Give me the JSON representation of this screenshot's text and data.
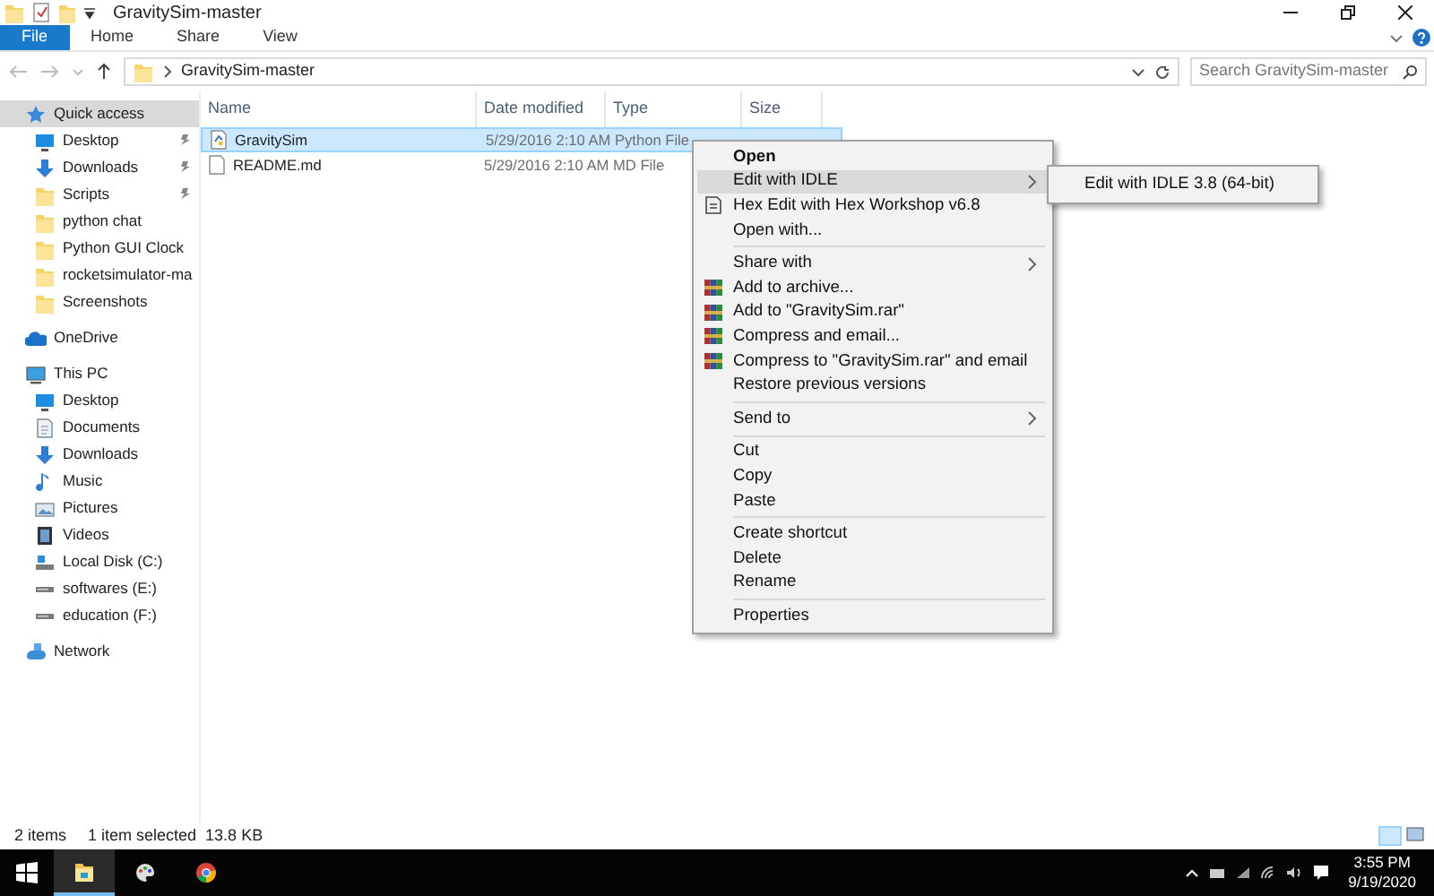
{
  "window": {
    "title": "GravitySim-master"
  },
  "ribbon_tabs": [
    {
      "label": "File",
      "selected": true
    },
    {
      "label": "Home",
      "selected": false
    },
    {
      "label": "Share",
      "selected": false
    },
    {
      "label": "View",
      "selected": false
    }
  ],
  "address": {
    "path": "GravitySim-master",
    "search_placeholder": "Search GravitySim-master"
  },
  "sidebar": {
    "items": [
      {
        "label": "Quick access",
        "kind": "star",
        "selected": true,
        "pinned": false,
        "children": [
          {
            "label": "Desktop",
            "kind": "desktop",
            "selected": false,
            "pinned": true
          },
          {
            "label": "Downloads",
            "kind": "download",
            "selected": false,
            "pinned": true
          },
          {
            "label": "Scripts",
            "kind": "folder",
            "selected": false,
            "pinned": true
          },
          {
            "label": "python chat",
            "kind": "folder",
            "selected": false,
            "pinned": false
          },
          {
            "label": "Python GUI Clock",
            "kind": "folder",
            "selected": false,
            "pinned": false
          },
          {
            "label": "rocketsimulator-ma",
            "kind": "folder",
            "selected": false,
            "pinned": false
          },
          {
            "label": "Screenshots",
            "kind": "folder",
            "selected": false,
            "pinned": false
          }
        ]
      },
      {
        "label": "OneDrive",
        "kind": "cloud",
        "selected": false,
        "pinned": false
      },
      {
        "label": "This PC",
        "kind": "pc",
        "selected": false,
        "pinned": false,
        "children": [
          {
            "label": "Desktop",
            "kind": "desktop",
            "selected": false,
            "pinned": false
          },
          {
            "label": "Documents",
            "kind": "document",
            "selected": false,
            "pinned": false
          },
          {
            "label": "Downloads",
            "kind": "download",
            "selected": false,
            "pinned": false
          },
          {
            "label": "Music",
            "kind": "music",
            "selected": false,
            "pinned": false
          },
          {
            "label": "Pictures",
            "kind": "pictures",
            "selected": false,
            "pinned": false
          },
          {
            "label": "Videos",
            "kind": "videos",
            "selected": false,
            "pinned": false
          },
          {
            "label": "Local Disk (C:)",
            "kind": "sysdrive",
            "selected": false,
            "pinned": false
          },
          {
            "label": "softwares (E:)",
            "kind": "drive",
            "selected": false,
            "pinned": false
          },
          {
            "label": "education (F:)",
            "kind": "drive",
            "selected": false,
            "pinned": false
          }
        ]
      },
      {
        "label": "Network",
        "kind": "network",
        "selected": false,
        "pinned": false
      }
    ]
  },
  "table": {
    "columns": [
      "Name",
      "Date modified",
      "Type",
      "Size"
    ],
    "rows": [
      {
        "name": "GravitySim",
        "kind": "python",
        "date": "5/29/2016 2:10 AM",
        "type": "Python File",
        "selected": true
      },
      {
        "name": "README.md",
        "kind": "text",
        "date": "5/29/2016 2:10 AM",
        "type": "MD File",
        "selected": false
      }
    ]
  },
  "context_menu": {
    "groups": [
      [
        {
          "label": "Open",
          "default": true,
          "selected": false,
          "submenu": false
        },
        {
          "label": "Edit with IDLE",
          "default": false,
          "selected": true,
          "submenu": true
        },
        {
          "label": "Hex Edit with Hex Workshop v6.8",
          "default": false,
          "selected": false,
          "submenu": false,
          "kind": "hex"
        },
        {
          "label": "Open with...",
          "default": false,
          "selected": false,
          "submenu": false
        }
      ],
      [
        {
          "label": "Share with",
          "default": false,
          "selected": false,
          "submenu": true
        },
        {
          "label": "Add to archive...",
          "default": false,
          "selected": false,
          "submenu": false,
          "kind": "archive"
        },
        {
          "label": "Add to \"GravitySim.rar\"",
          "default": false,
          "selected": false,
          "submenu": false,
          "kind": "archive"
        },
        {
          "label": "Compress and email...",
          "default": false,
          "selected": false,
          "submenu": false,
          "kind": "archive"
        },
        {
          "label": "Compress to \"GravitySim.rar\" and email",
          "default": false,
          "selected": false,
          "submenu": false,
          "kind": "archive"
        },
        {
          "label": "Restore previous versions",
          "default": false,
          "selected": false,
          "submenu": false
        }
      ],
      [
        {
          "label": "Send to",
          "default": false,
          "selected": false,
          "submenu": true
        }
      ],
      [
        {
          "label": "Cut",
          "default": false,
          "selected": false,
          "submenu": false
        },
        {
          "label": "Copy",
          "default": false,
          "selected": false,
          "submenu": false
        },
        {
          "label": "Paste",
          "default": false,
          "selected": false,
          "submenu": false
        }
      ],
      [
        {
          "label": "Create shortcut",
          "default": false,
          "selected": false,
          "submenu": false
        },
        {
          "label": "Delete",
          "default": false,
          "selected": false,
          "submenu": false
        },
        {
          "label": "Rename",
          "default": false,
          "selected": false,
          "submenu": false
        }
      ],
      [
        {
          "label": "Properties",
          "default": false,
          "selected": false,
          "submenu": false
        }
      ]
    ],
    "submenu": [
      "Edit with IDLE 3.8 (64-bit)"
    ]
  },
  "status_bar": {
    "count": "2 items",
    "selection": "1 item selected  13.8 KB"
  },
  "taskbar": {
    "apps": [
      {
        "kind": "explorer",
        "selected": true
      },
      {
        "kind": "paint",
        "selected": false
      },
      {
        "kind": "chrome",
        "selected": false
      }
    ],
    "time": "3:55 PM",
    "date": "9/19/2020"
  }
}
